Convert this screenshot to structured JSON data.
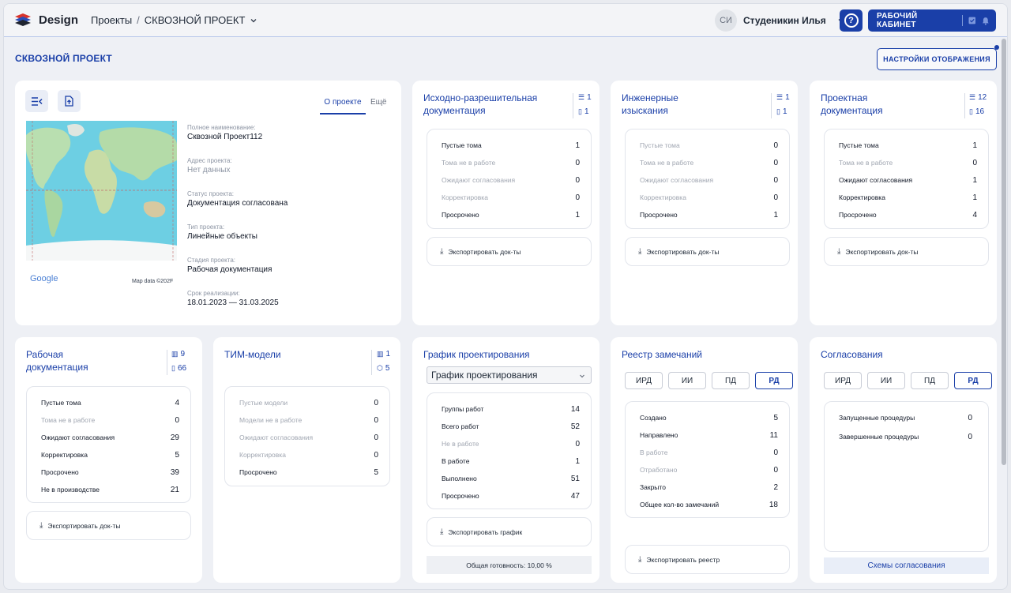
{
  "topbar": {
    "brand": "Design",
    "breadcrumb_projects": "Проекты",
    "breadcrumb_sep": "/",
    "breadcrumb_project": "СКВОЗНОЙ ПРОЕКТ",
    "user_initials": "СИ",
    "user_name": "Студеникин Илья",
    "help": "?",
    "cabinet_label": "РАБОЧИЙ КАБИНЕТ"
  },
  "page": {
    "title": "СКВОЗНОЙ ПРОЕКТ",
    "settings_label": "НАСТРОЙКИ ОТОБРАЖЕНИЯ"
  },
  "project": {
    "tab_about": "О проекте",
    "tab_more": "Ещё",
    "map_brand": "Google",
    "map_data": "Map data ©202F",
    "fields": [
      {
        "label": "Полное наименование:",
        "value": "Сквозной Проект112"
      },
      {
        "label": "Адрес проекта:",
        "value": "Нет данных"
      },
      {
        "label": "Статус проекта:",
        "value": "Документация согласована"
      },
      {
        "label": "Тип проекта:",
        "value": "Линейные объекты"
      },
      {
        "label": "Стадия проекта:",
        "value": "Рабочая документация"
      },
      {
        "label": "Срок реализации:",
        "value": "18.01.2023 — 31.03.2025"
      }
    ]
  },
  "ird": {
    "title1": "Исходно-разрешительная",
    "title2": "документация",
    "count_a": "1",
    "count_b": "1",
    "rows": [
      {
        "label": "Пустые тома",
        "value": "1"
      },
      {
        "label": "Тома не в работе",
        "value": "0"
      },
      {
        "label": "Ожидают согласования",
        "value": "0"
      },
      {
        "label": "Корректировка",
        "value": "0"
      },
      {
        "label": "Просрочено",
        "value": "1"
      }
    ],
    "export": "Экспортировать док-ты"
  },
  "ii": {
    "title1": "Инженерные",
    "title2": "изыскания",
    "count_a": "1",
    "count_b": "1",
    "rows": [
      {
        "label": "Пустые тома",
        "value": "0"
      },
      {
        "label": "Тома не в работе",
        "value": "0"
      },
      {
        "label": "Ожидают согласования",
        "value": "0"
      },
      {
        "label": "Корректировка",
        "value": "0"
      },
      {
        "label": "Просрочено",
        "value": "1"
      }
    ],
    "export": "Экспортировать док-ты"
  },
  "pd": {
    "title1": "Проектная",
    "title2": "документация",
    "count_a": "12",
    "count_b": "16",
    "rows": [
      {
        "label": "Пустые тома",
        "value": "1"
      },
      {
        "label": "Тома не в работе",
        "value": "0"
      },
      {
        "label": "Ожидают согласования",
        "value": "1"
      },
      {
        "label": "Корректировка",
        "value": "1"
      },
      {
        "label": "Просрочено",
        "value": "4"
      }
    ],
    "export": "Экспортировать док-ты"
  },
  "rd": {
    "title1": "Рабочая",
    "title2": "документация",
    "count_a": "9",
    "count_b": "66",
    "rows": [
      {
        "label": "Пустые тома",
        "value": "4"
      },
      {
        "label": "Тома не в работе",
        "value": "0"
      },
      {
        "label": "Ожидают согласования",
        "value": "29"
      },
      {
        "label": "Корректировка",
        "value": "5"
      },
      {
        "label": "Просрочено",
        "value": "39"
      },
      {
        "label": "Не в производстве",
        "value": "21"
      }
    ],
    "export": "Экспортировать док-ты"
  },
  "tim": {
    "title": "ТИМ-модели",
    "count_a": "1",
    "count_b": "5",
    "rows": [
      {
        "label": "Пустые модели",
        "value": "0"
      },
      {
        "label": "Модели не в работе",
        "value": "0"
      },
      {
        "label": "Ожидают согласования",
        "value": "0"
      },
      {
        "label": "Корректировка",
        "value": "0"
      },
      {
        "label": "Просрочено",
        "value": "5"
      }
    ]
  },
  "schedule": {
    "title": "График проектирования",
    "select_value": "График проектирования",
    "rows": [
      {
        "label": "Группы работ",
        "value": "14"
      },
      {
        "label": "Всего работ",
        "value": "52"
      },
      {
        "label": "Не в работе",
        "value": "0"
      },
      {
        "label": "В работе",
        "value": "1"
      },
      {
        "label": "Выполнено",
        "value": "51"
      },
      {
        "label": "Просрочено",
        "value": "47"
      }
    ],
    "export": "Экспортировать график",
    "readiness": "Общая готовность: 10,00 %"
  },
  "remarks": {
    "title": "Реестр замечаний",
    "tabs": [
      "ИРД",
      "ИИ",
      "ПД",
      "РД"
    ],
    "rows": [
      {
        "label": "Создано",
        "value": "5"
      },
      {
        "label": "Направлено",
        "value": "11"
      },
      {
        "label": "В работе",
        "value": "0"
      },
      {
        "label": "Отработано",
        "value": "0"
      },
      {
        "label": "Закрыто",
        "value": "2"
      },
      {
        "label": "Общее кол-во замечаний",
        "value": "18"
      }
    ],
    "export": "Экспортировать реестр"
  },
  "approvals": {
    "title": "Согласования",
    "tabs": [
      "ИРД",
      "ИИ",
      "ПД",
      "РД"
    ],
    "rows": [
      {
        "label": "Запущенные процедуры",
        "value": "0"
      },
      {
        "label": "Завершенные процедуры",
        "value": "0"
      }
    ],
    "schemes": "Схемы согласования"
  }
}
